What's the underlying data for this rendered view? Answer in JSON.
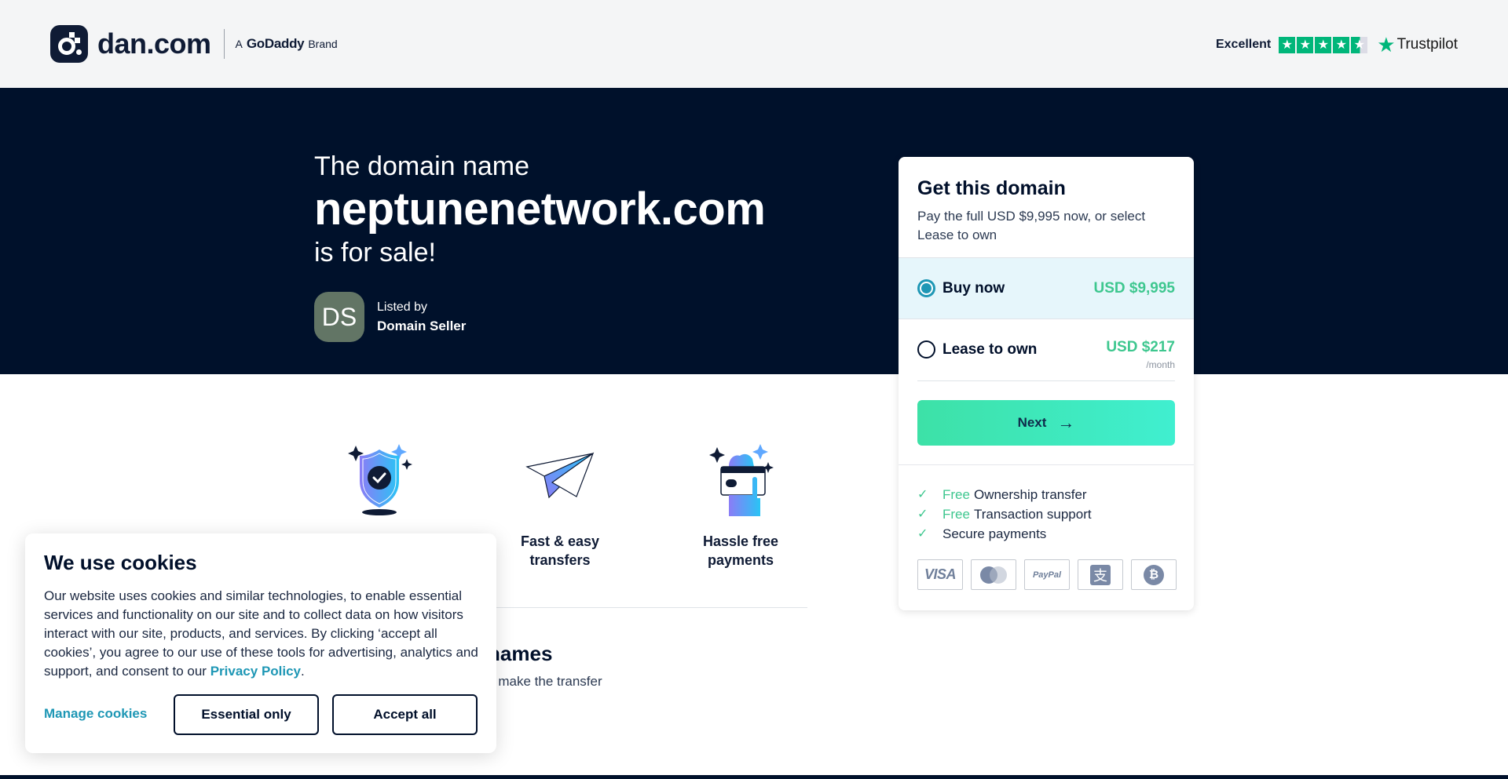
{
  "header": {
    "logo_text": "dan.com",
    "brand_prefix": "A",
    "brand_name": "GoDaddy",
    "brand_suffix": "Brand",
    "trustpilot": {
      "rating_label": "Excellent",
      "stars": 4.5,
      "max_stars": 5,
      "provider": "Trustpilot"
    }
  },
  "hero": {
    "line1": "The domain name",
    "domain": "neptunenetwork.com",
    "line3": "is for sale!",
    "seller": {
      "initials": "DS",
      "listed_by_label": "Listed by",
      "name": "Domain Seller"
    }
  },
  "purchase_card": {
    "title": "Get this domain",
    "description": "Pay the full USD $9,995 now, or select Lease to own",
    "options": [
      {
        "label": "Buy now",
        "price": "USD $9,995",
        "period": "",
        "selected": true
      },
      {
        "label": "Lease to own",
        "price": "USD $217",
        "period": "/month",
        "selected": false
      }
    ],
    "next_label": "Next",
    "benefits": [
      {
        "highlight": "Free",
        "text": "Ownership transfer"
      },
      {
        "highlight": "Free",
        "text": "Transaction support"
      },
      {
        "highlight": "",
        "text": "Secure payments"
      }
    ],
    "payment_methods": [
      {
        "name": "visa-icon",
        "label": "VISA"
      },
      {
        "name": "mastercard-icon",
        "label": ""
      },
      {
        "name": "paypal-icon",
        "label": "PayPal"
      },
      {
        "name": "alipay-icon",
        "label": "支"
      },
      {
        "name": "bitcoin-icon",
        "label": "₿"
      }
    ]
  },
  "features": [
    {
      "icon": "shield-check-icon",
      "label": ""
    },
    {
      "icon": "paper-plane-icon",
      "label": "Fast & easy transfers"
    },
    {
      "icon": "hand-card-icon",
      "label": "Hassle free payments"
    }
  ],
  "why_section": {
    "title_visible": "ay to buy domain names",
    "text_visible": "n you want to buy or lease, we make the transfer"
  },
  "cookie_banner": {
    "title": "We use cookies",
    "text": "Our website uses cookies and similar technologies, to enable essential services and functionality on our site and to collect data on how visitors interact with our site, products, and services. By clicking ‘accept all cookies’, you agree to our use of these tools for advertising, analytics and support, and consent to our",
    "link_label": "Privacy Policy",
    "manage_label": "Manage cookies",
    "essential_label": "Essential only",
    "accept_label": "Accept all"
  },
  "colors": {
    "navy": "#00112b",
    "accent_green": "#3ec78f",
    "accent_teal": "#1e97b5",
    "selected_bg": "#e6f6fb"
  }
}
